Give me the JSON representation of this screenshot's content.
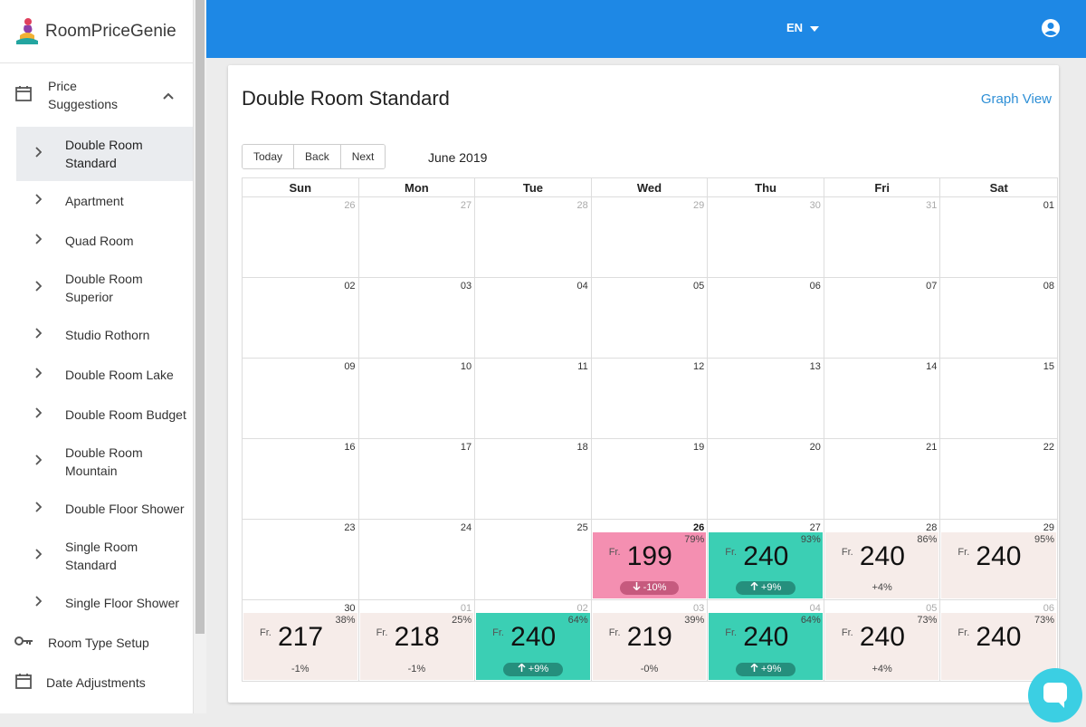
{
  "app": {
    "name": "RoomPriceGenie"
  },
  "topbar": {
    "language": "EN"
  },
  "sidebar": {
    "group": {
      "label_line1": "Price",
      "label_line2": "Suggestions"
    },
    "items": [
      {
        "label": "Double Room Standard",
        "active": true
      },
      {
        "label": "Apartment"
      },
      {
        "label": "Quad Room"
      },
      {
        "label": "Double Room Superior"
      },
      {
        "label": "Studio Rothorn"
      },
      {
        "label": "Double Room Lake"
      },
      {
        "label": "Double Room Budget"
      },
      {
        "label": "Double Room Mountain"
      },
      {
        "label": "Double Floor Shower"
      },
      {
        "label": "Single Room Standard"
      },
      {
        "label": "Single Floor Shower"
      }
    ],
    "bottom": [
      {
        "label": "Room Type Setup",
        "icon": "key-icon"
      },
      {
        "label": "Date Adjustments",
        "icon": "calendar-icon"
      }
    ]
  },
  "main": {
    "title": "Double Room Standard",
    "graph_view": "Graph View",
    "buttons": {
      "today": "Today",
      "back": "Back",
      "next": "Next"
    },
    "month": "June 2019",
    "weekdays": [
      "Sun",
      "Mon",
      "Tue",
      "Wed",
      "Thu",
      "Fri",
      "Sat"
    ],
    "weeks": [
      [
        {
          "d": "26",
          "o": true
        },
        {
          "d": "27",
          "o": true
        },
        {
          "d": "28",
          "o": true
        },
        {
          "d": "29",
          "o": true
        },
        {
          "d": "30",
          "o": true
        },
        {
          "d": "31",
          "o": true
        },
        {
          "d": "01"
        }
      ],
      [
        {
          "d": "02"
        },
        {
          "d": "03"
        },
        {
          "d": "04"
        },
        {
          "d": "05"
        },
        {
          "d": "06"
        },
        {
          "d": "07"
        },
        {
          "d": "08"
        }
      ],
      [
        {
          "d": "09"
        },
        {
          "d": "10"
        },
        {
          "d": "11"
        },
        {
          "d": "12"
        },
        {
          "d": "13"
        },
        {
          "d": "14"
        },
        {
          "d": "15"
        }
      ],
      [
        {
          "d": "16"
        },
        {
          "d": "17"
        },
        {
          "d": "18"
        },
        {
          "d": "19"
        },
        {
          "d": "20"
        },
        {
          "d": "21"
        },
        {
          "d": "22"
        }
      ],
      [
        {
          "d": "23"
        },
        {
          "d": "24"
        },
        {
          "d": "25"
        },
        {
          "d": "26",
          "today": true,
          "price": {
            "prefix": "Fr.",
            "value": "199",
            "occ": "79%",
            "change": "-10%",
            "style": "pink",
            "arrow": "down"
          }
        },
        {
          "d": "27",
          "price": {
            "prefix": "Fr.",
            "value": "240",
            "occ": "93%",
            "change": "+9%",
            "style": "teal",
            "arrow": "up"
          }
        },
        {
          "d": "28",
          "price": {
            "prefix": "Fr.",
            "value": "240",
            "occ": "86%",
            "change": "+4%",
            "style": "plain"
          }
        },
        {
          "d": "29",
          "price": {
            "prefix": "Fr.",
            "value": "240",
            "occ": "95%",
            "change": "",
            "style": "plain"
          }
        }
      ],
      [
        {
          "d": "30",
          "price": {
            "prefix": "Fr.",
            "value": "217",
            "occ": "38%",
            "change": "-1%",
            "style": "plain"
          }
        },
        {
          "d": "01",
          "o": true,
          "price": {
            "prefix": "Fr.",
            "value": "218",
            "occ": "25%",
            "change": "-1%",
            "style": "plain"
          }
        },
        {
          "d": "02",
          "o": true,
          "price": {
            "prefix": "Fr.",
            "value": "240",
            "occ": "64%",
            "change": "+9%",
            "style": "teal",
            "arrow": "up"
          }
        },
        {
          "d": "03",
          "o": true,
          "price": {
            "prefix": "Fr.",
            "value": "219",
            "occ": "39%",
            "change": "-0%",
            "style": "plain"
          }
        },
        {
          "d": "04",
          "o": true,
          "price": {
            "prefix": "Fr.",
            "value": "240",
            "occ": "64%",
            "change": "+9%",
            "style": "teal",
            "arrow": "up"
          }
        },
        {
          "d": "05",
          "o": true,
          "price": {
            "prefix": "Fr.",
            "value": "240",
            "occ": "73%",
            "change": "+4%",
            "style": "plain"
          }
        },
        {
          "d": "06",
          "o": true,
          "price": {
            "prefix": "Fr.",
            "value": "240",
            "occ": "73%",
            "change": "",
            "style": "plain"
          }
        }
      ]
    ]
  },
  "colors": {
    "topbar": "#1e88e5",
    "link": "#2e8fd6",
    "pink": "#f48fb1",
    "teal": "#3bcfb4",
    "plain": "#f6ece9"
  }
}
